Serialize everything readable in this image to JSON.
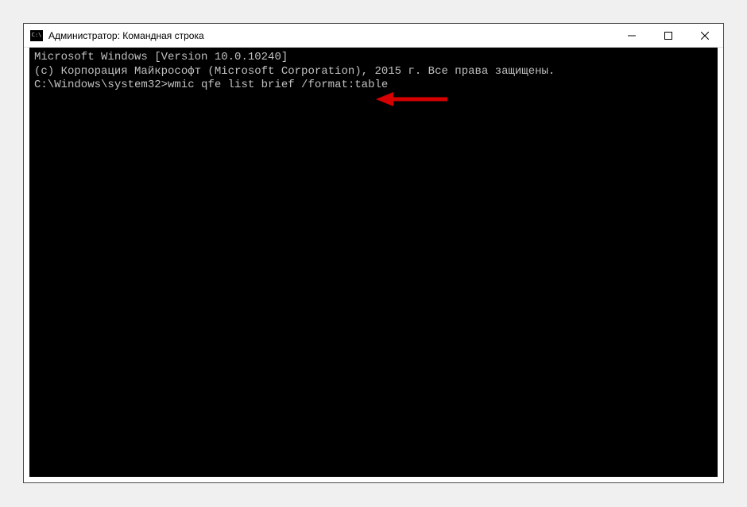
{
  "window": {
    "title": "Администратор: Командная строка"
  },
  "terminal": {
    "line1": "Microsoft Windows [Version 10.0.10240]",
    "line2": "(c) Корпорация Майкрософт (Microsoft Corporation), 2015 г. Все права защищены.",
    "blank": "",
    "prompt": "C:\\Windows\\system32>",
    "command": "wmic qfe list brief /format:table"
  },
  "annotation": {
    "arrow_color": "#d60000"
  }
}
